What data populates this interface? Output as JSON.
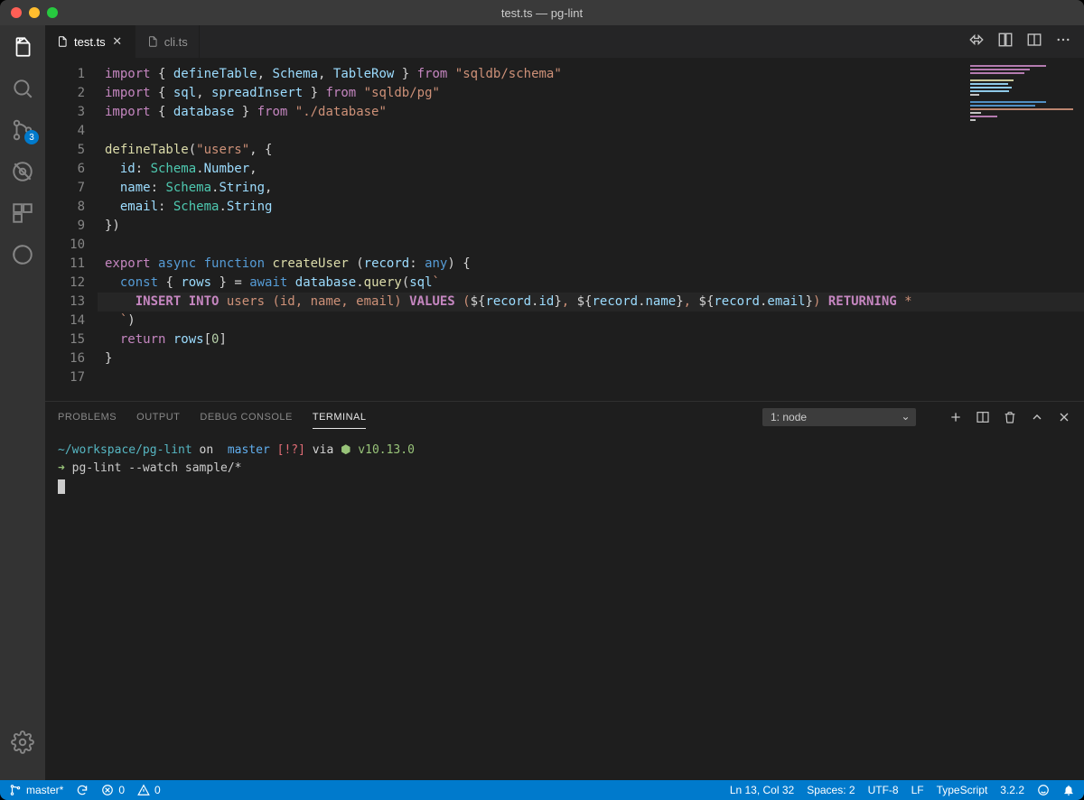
{
  "window": {
    "title": "test.ts — pg-lint"
  },
  "activity": {
    "badge_scm": "3"
  },
  "tabs": [
    {
      "name": "test.ts",
      "active": true
    },
    {
      "name": "cli.ts",
      "active": false
    }
  ],
  "editor": {
    "line_numbers": [
      "1",
      "2",
      "3",
      "4",
      "5",
      "6",
      "7",
      "8",
      "9",
      "10",
      "11",
      "12",
      "13",
      "14",
      "15",
      "16",
      "17"
    ],
    "highlight_line": 13,
    "lines": [
      [
        [
          "kw",
          "import"
        ],
        [
          "pn",
          " { "
        ],
        [
          "id",
          "defineTable"
        ],
        [
          "pn",
          ", "
        ],
        [
          "id",
          "Schema"
        ],
        [
          "pn",
          ", "
        ],
        [
          "id",
          "TableRow"
        ],
        [
          "pn",
          " } "
        ],
        [
          "kw",
          "from"
        ],
        [
          "pn",
          " "
        ],
        [
          "str",
          "\"sqldb/schema\""
        ]
      ],
      [
        [
          "kw",
          "import"
        ],
        [
          "pn",
          " { "
        ],
        [
          "id",
          "sql"
        ],
        [
          "pn",
          ", "
        ],
        [
          "id",
          "spreadInsert"
        ],
        [
          "pn",
          " } "
        ],
        [
          "kw",
          "from"
        ],
        [
          "pn",
          " "
        ],
        [
          "str",
          "\"sqldb/pg\""
        ]
      ],
      [
        [
          "kw",
          "import"
        ],
        [
          "pn",
          " { "
        ],
        [
          "id",
          "database"
        ],
        [
          "pn",
          " } "
        ],
        [
          "kw",
          "from"
        ],
        [
          "pn",
          " "
        ],
        [
          "str",
          "\"./database\""
        ]
      ],
      [],
      [
        [
          "fn",
          "defineTable"
        ],
        [
          "pn",
          "("
        ],
        [
          "str",
          "\"users\""
        ],
        [
          "pn",
          ", {"
        ]
      ],
      [
        [
          "pn",
          "  "
        ],
        [
          "id",
          "id"
        ],
        [
          "pn",
          ": "
        ],
        [
          "ty",
          "Schema"
        ],
        [
          "pn",
          "."
        ],
        [
          "id",
          "Number"
        ],
        [
          "pn",
          ","
        ]
      ],
      [
        [
          "pn",
          "  "
        ],
        [
          "id",
          "name"
        ],
        [
          "pn",
          ": "
        ],
        [
          "ty",
          "Schema"
        ],
        [
          "pn",
          "."
        ],
        [
          "id",
          "String"
        ],
        [
          "pn",
          ","
        ]
      ],
      [
        [
          "pn",
          "  "
        ],
        [
          "id",
          "email"
        ],
        [
          "pn",
          ": "
        ],
        [
          "ty",
          "Schema"
        ],
        [
          "pn",
          "."
        ],
        [
          "id",
          "String"
        ]
      ],
      [
        [
          "pn",
          "})"
        ]
      ],
      [],
      [
        [
          "kw",
          "export"
        ],
        [
          "pn",
          " "
        ],
        [
          "kw2",
          "async"
        ],
        [
          "pn",
          " "
        ],
        [
          "kw2",
          "function"
        ],
        [
          "pn",
          " "
        ],
        [
          "fn",
          "createUser"
        ],
        [
          "pn",
          " ("
        ],
        [
          "id",
          "record"
        ],
        [
          "pn",
          ": "
        ],
        [
          "kw2",
          "any"
        ],
        [
          "pn",
          ") {"
        ]
      ],
      [
        [
          "pn",
          "  "
        ],
        [
          "kw2",
          "const"
        ],
        [
          "pn",
          " { "
        ],
        [
          "id",
          "rows"
        ],
        [
          "pn",
          " } = "
        ],
        [
          "kw2",
          "await"
        ],
        [
          "pn",
          " "
        ],
        [
          "id",
          "database"
        ],
        [
          "pn",
          "."
        ],
        [
          "fn",
          "query"
        ],
        [
          "pn",
          "("
        ],
        [
          "id",
          "sql"
        ],
        [
          "str",
          "`"
        ]
      ],
      [
        [
          "str",
          "    "
        ],
        [
          "sqlkw",
          "INSERT INTO"
        ],
        [
          "sql",
          " users (id, name, email) "
        ],
        [
          "sqlkw",
          "VALUES"
        ],
        [
          "sql",
          " ("
        ],
        [
          "pn",
          "${"
        ],
        [
          "id",
          "record"
        ],
        [
          "pn",
          "."
        ],
        [
          "id",
          "id"
        ],
        [
          "pn",
          "}"
        ],
        [
          "sql",
          ", "
        ],
        [
          "pn",
          "${"
        ],
        [
          "id",
          "record"
        ],
        [
          "pn",
          "."
        ],
        [
          "id",
          "name"
        ],
        [
          "pn",
          "}"
        ],
        [
          "sql",
          ", "
        ],
        [
          "pn",
          "${"
        ],
        [
          "id",
          "record"
        ],
        [
          "pn",
          "."
        ],
        [
          "id",
          "email"
        ],
        [
          "pn",
          "}"
        ],
        [
          "sql",
          ") "
        ],
        [
          "sqlkw",
          "RETURNING"
        ],
        [
          "sql",
          " *"
        ]
      ],
      [
        [
          "pn",
          "  "
        ],
        [
          "str",
          "`"
        ],
        [
          "pn",
          ")"
        ]
      ],
      [
        [
          "pn",
          "  "
        ],
        [
          "kw",
          "return"
        ],
        [
          "pn",
          " "
        ],
        [
          "id",
          "rows"
        ],
        [
          "pn",
          "["
        ],
        [
          "num",
          "0"
        ],
        [
          "pn",
          "]"
        ]
      ],
      [
        [
          "pn",
          "}"
        ]
      ],
      []
    ]
  },
  "panel": {
    "tabs": {
      "problems": "PROBLEMS",
      "output": "OUTPUT",
      "debug": "DEBUG CONSOLE",
      "terminal": "TERMINAL"
    },
    "active_tab": "terminal",
    "terminal_select": "1: node",
    "terminal": {
      "path": "~/workspace/pg-lint",
      "on": " on ",
      "branch_icon": "",
      "branch": " master ",
      "flags": "[!?]",
      "via": " via ",
      "node_dot": "⬢",
      "node_version": " v10.13.0",
      "prompt": "➜",
      "command": " pg-lint --watch sample/*"
    }
  },
  "status": {
    "branch": "master*",
    "errors": "0",
    "warnings": "0",
    "position": "Ln 13, Col 32",
    "spaces": "Spaces: 2",
    "encoding": "UTF-8",
    "eol": "LF",
    "language": "TypeScript",
    "version": "3.2.2"
  }
}
